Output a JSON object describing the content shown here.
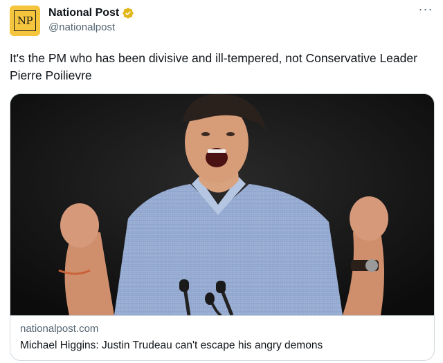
{
  "account": {
    "display_name": "National Post",
    "handle": "@nationalpost",
    "avatar_text": "NP",
    "verified_color": "#e2b719"
  },
  "more_menu": {
    "icon": "more-horizontal-icon",
    "label": "···"
  },
  "tweet": {
    "text": "It's the PM who has been divisive and ill-tempered, not Conservative Leader Pierre Poilievre"
  },
  "link_card": {
    "domain": "nationalpost.com",
    "title": "Michael Higgins: Justin Trudeau can't escape his angry demons"
  }
}
